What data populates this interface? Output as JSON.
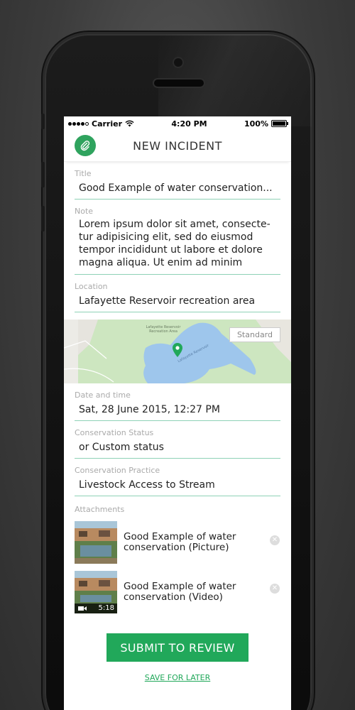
{
  "status_bar": {
    "carrier": "Carrier",
    "time": "4:20 PM",
    "battery": "100%"
  },
  "header": {
    "title": "NEW INCIDENT",
    "attach_icon": "paperclip-icon"
  },
  "fields": {
    "title": {
      "label": "Title",
      "value": "Good Example of water conservation..."
    },
    "note": {
      "label": "Note",
      "value": "Lorem ipsum dolor sit amet, consecte-tur adipisicing elit, sed do eiusmod tempor incididunt ut labore et dolore magna aliqua. Ut enim ad minim"
    },
    "location": {
      "label": "Location",
      "value": "Lafayette Reservoir recreation area"
    },
    "datetime": {
      "label": "Date and time",
      "value": "Sat, 28 June 2015, 12:27 PM"
    },
    "status": {
      "label": "Conservation Status",
      "value": "or Custom status"
    },
    "practice": {
      "label": "Conservation Practice",
      "value": "Livestock Access to Stream"
    }
  },
  "map": {
    "label_area": "Lafayette Reservoir Recreation Area",
    "label_water": "Lafayette Reservoir",
    "standard_button": "Standard"
  },
  "attachments": {
    "label": "Attachments",
    "items": [
      {
        "title": "Good Example of water conservation (Picture)"
      },
      {
        "title": "Good Example of water conservation (Video)",
        "duration": "5:18"
      }
    ]
  },
  "actions": {
    "submit": "SUBMIT TO REVIEW",
    "save_later": "SAVE FOR LATER"
  },
  "colors": {
    "accent": "#21a85a",
    "field_underline": "#8ed1b6"
  }
}
